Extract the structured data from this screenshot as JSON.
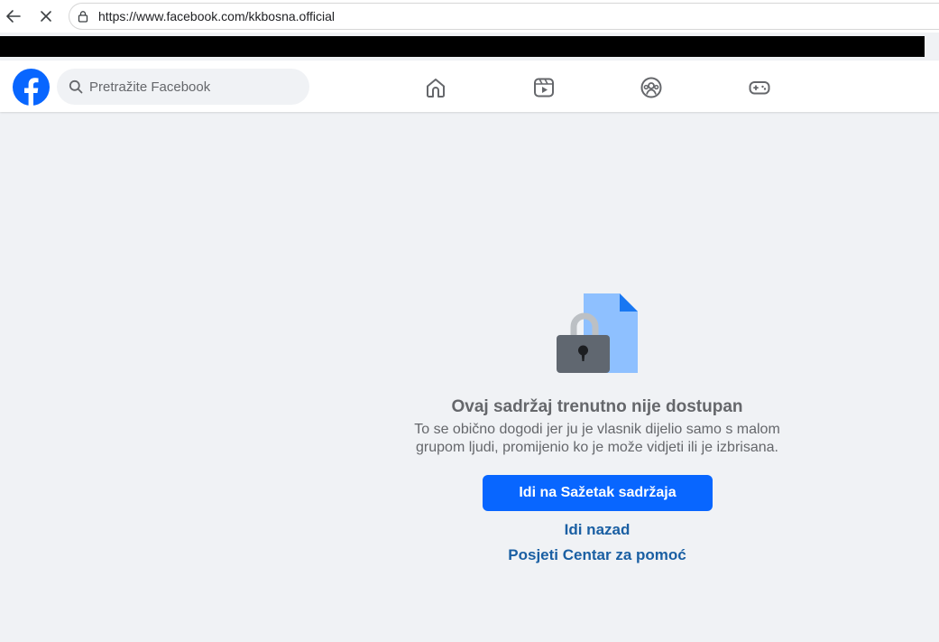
{
  "browser": {
    "url": "https://www.facebook.com/kkbosna.official",
    "icons": {
      "back": "back-arrow-icon",
      "stop": "close-icon",
      "lock": "lock-icon"
    }
  },
  "header": {
    "search_placeholder": "Pretražite Facebook",
    "nav": [
      "home-icon",
      "reels-icon",
      "groups-icon",
      "gaming-icon"
    ],
    "brand_color": "#0866ff"
  },
  "main": {
    "title": "Ovaj sadržaj trenutno nije dostupan",
    "description_line1": "To se obično dogodi jer ju je vlasnik dijelio samo s malom",
    "description_line2": "grupom ljudi, promijenio ko je može vidjeti ili je izbrisana.",
    "primary_button": "Idi na Sažetak sadržaja",
    "back_link": "Idi nazad",
    "help_link": "Posjeti Centar za pomoć",
    "illustration": "locked-document-icon"
  },
  "colors": {
    "background": "#f0f2f5",
    "text_muted": "#65676b",
    "link": "#1a5fa3"
  }
}
